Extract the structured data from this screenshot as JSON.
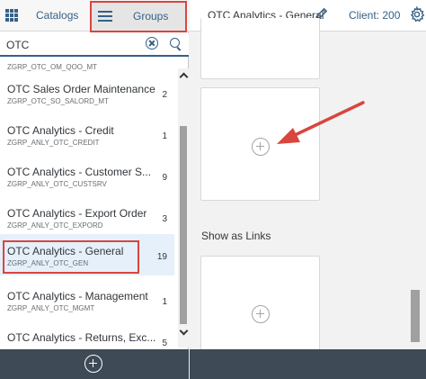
{
  "tabs": {
    "catalogs": "Catalogs",
    "groups": "Groups"
  },
  "search": {
    "value": "OTC"
  },
  "list": {
    "partial_sub": "ZGRP_OTC_OM_QOO_MT",
    "items": [
      {
        "title": "OTC Sales Order Maintenance",
        "sub": "ZGRP_OTC_SO_SALORD_MT",
        "count": "2"
      },
      {
        "title": "OTC Analytics - Credit",
        "sub": "ZGRP_ANLY_OTC_CREDIT",
        "count": "1"
      },
      {
        "title": "OTC Analytics - Customer S...",
        "sub": "ZGRP_ANLY_OTC_CUSTSRV",
        "count": "9"
      },
      {
        "title": "OTC Analytics - Export Order",
        "sub": "ZGRP_ANLY_OTC_EXPORD",
        "count": "3"
      },
      {
        "title": "OTC Analytics - General",
        "sub": "ZGRP_ANLY_OTC_GEN",
        "count": "19"
      },
      {
        "title": "OTC Analytics - Management",
        "sub": "ZGRP_ANLY_OTC_MGMT",
        "count": "1"
      },
      {
        "title": "OTC Analytics - Returns, Exc...",
        "sub": "",
        "count": "5"
      }
    ]
  },
  "header": {
    "group_title": "OTC Analytics - General",
    "client": "Client: 200"
  },
  "content": {
    "links_section": "Show as Links"
  },
  "icons": {
    "apps": "grid-icon",
    "menu": "hamburger-icon",
    "clear": "clear-icon",
    "search": "search-icon",
    "edit": "pencil-icon",
    "settings": "gear-icon",
    "add": "plus-circle-icon",
    "pointer": "arrow-icon"
  },
  "colors": {
    "accent": "#346187",
    "highlight": "#d9453f",
    "selected_bg": "#e5f0fa",
    "footer": "#3e4a55"
  }
}
